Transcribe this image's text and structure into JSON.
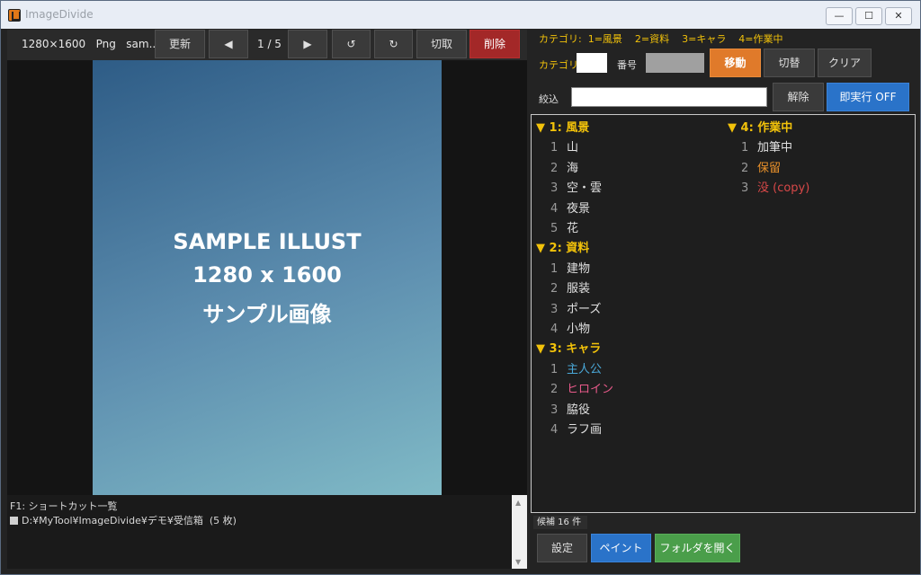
{
  "window": {
    "title": "ImageDivide",
    "min_glyph": "—",
    "max_glyph": "☐",
    "close_glyph": "✕"
  },
  "toolbar": {
    "file_info": "1280×1600   Png   sam...",
    "refresh_label": "更新",
    "prev_glyph": "◀",
    "page_indicator": "1 / 5",
    "next_glyph": "▶",
    "rotate_left_glyph": "↺",
    "rotate_right_glyph": "↻",
    "crop_label": "切取",
    "delete_label": "削除"
  },
  "image": {
    "line1": "SAMPLE ILLUST",
    "line2": "1280 x 1600",
    "line3": "サンプル画像"
  },
  "log": {
    "line1": "F1: ショートカット一覧",
    "line2": "D:¥MyTool¥ImageDivide¥デモ¥受信箱  (5 枚)"
  },
  "right": {
    "legend": "カテゴリ:  1=風景    2=資料    3=キャラ    4=作業中",
    "category_label": "カテゴリ",
    "number_label": "番号",
    "move_label": "移動",
    "switch_label": "切替",
    "clear_label": "クリア",
    "filter_label": "絞込",
    "filter_value": "",
    "unset_label": "解除",
    "instant_label": "即実行 OFF",
    "status": "候補 16 件",
    "settings_label": "設定",
    "paint_label": "ペイント",
    "open_folder_label": "フォルダを開く"
  },
  "categories": [
    {
      "header": "▼ 1: 風景",
      "items": [
        {
          "n": "1",
          "label": "山"
        },
        {
          "n": "2",
          "label": "海"
        },
        {
          "n": "3",
          "label": "空・雲"
        },
        {
          "n": "4",
          "label": "夜景"
        },
        {
          "n": "5",
          "label": "花"
        }
      ]
    },
    {
      "header": "▼ 2: 資料",
      "items": [
        {
          "n": "1",
          "label": "建物"
        },
        {
          "n": "2",
          "label": "服装"
        },
        {
          "n": "3",
          "label": "ポーズ"
        },
        {
          "n": "4",
          "label": "小物"
        }
      ]
    },
    {
      "header": "▼ 3: キャラ",
      "items": [
        {
          "n": "1",
          "label": "主人公",
          "color": "#4aa8d8"
        },
        {
          "n": "2",
          "label": "ヒロイン",
          "color": "#e85a8a"
        },
        {
          "n": "3",
          "label": "脇役"
        },
        {
          "n": "4",
          "label": "ラフ画"
        }
      ]
    },
    {
      "header": "▼ 4: 作業中",
      "items": [
        {
          "n": "1",
          "label": "加筆中"
        },
        {
          "n": "2",
          "label": "保留",
          "color": "#e8902a"
        },
        {
          "n": "3",
          "label": "没 (copy)",
          "color": "#d84848"
        }
      ]
    }
  ]
}
